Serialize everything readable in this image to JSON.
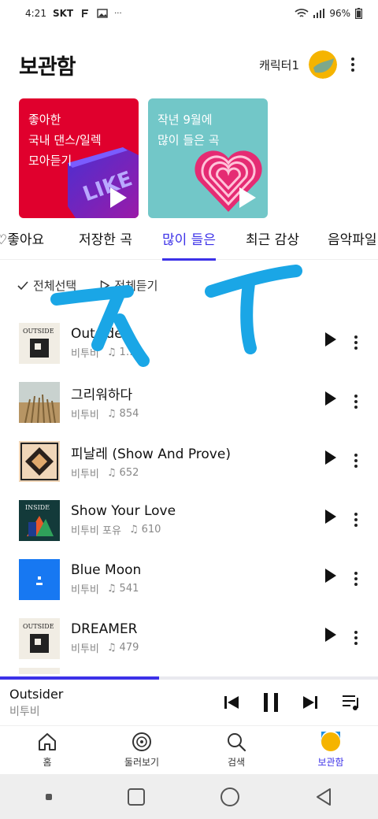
{
  "status_bar": {
    "time": "4:21",
    "carrier": "SKT",
    "battery": "96%"
  },
  "header": {
    "title": "보관함",
    "character_label": "캐릭터1"
  },
  "cards": [
    {
      "text": "좋아한\n국내 댄스/일렉\n모아듣기"
    },
    {
      "text": "작년 9월에\n많이 들은 곡"
    }
  ],
  "tabs": [
    {
      "label": "좋아요",
      "active": false
    },
    {
      "label": "저장한 곡",
      "active": false
    },
    {
      "label": "많이 들은",
      "active": true
    },
    {
      "label": "최근 감상",
      "active": false
    },
    {
      "label": "음악파일",
      "active": false
    }
  ],
  "select_bar": {
    "select_all": "전체선택",
    "play_all": "전체듣기"
  },
  "songs": [
    {
      "title": "Outsider",
      "artist": "비투비",
      "plays": "1…"
    },
    {
      "title": "그리워하다",
      "artist": "비투비",
      "plays": "854"
    },
    {
      "title": "피날레 (Show And Prove)",
      "artist": "비투비",
      "plays": "652"
    },
    {
      "title": "Show Your Love",
      "artist": "비투비 포유",
      "plays": "610"
    },
    {
      "title": "Blue Moon",
      "artist": "비투비",
      "plays": "541"
    },
    {
      "title": "DREAMER",
      "artist": "비투비",
      "plays": "479"
    }
  ],
  "player": {
    "title": "Outsider",
    "artist": "비투비",
    "progress": 0.42
  },
  "bottom_nav": [
    {
      "label": "홈",
      "icon": "home-icon",
      "active": false
    },
    {
      "label": "둘러보기",
      "icon": "browse-icon",
      "active": false
    },
    {
      "label": "검색",
      "icon": "search-icon",
      "active": false
    },
    {
      "label": "보관함",
      "icon": "library-icon",
      "active": true
    }
  ],
  "colors": {
    "accent": "#3c31e8",
    "card_red": "#e0002d",
    "card_teal": "#72c7c8",
    "scribble": "#1aa6e6"
  }
}
